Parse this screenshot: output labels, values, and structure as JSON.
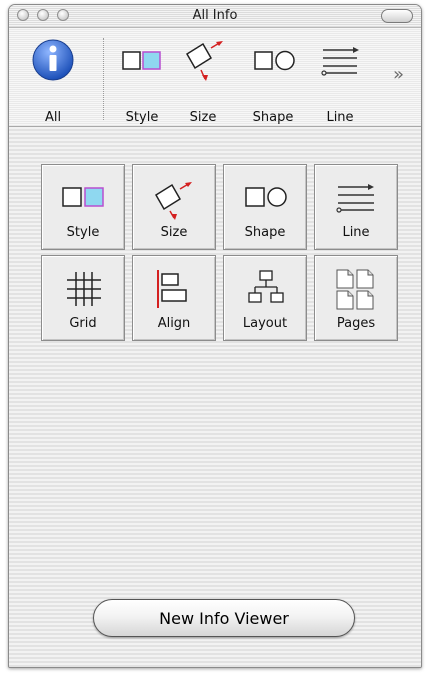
{
  "window": {
    "title": "All Info"
  },
  "toolbar": {
    "items": [
      {
        "label": "All",
        "icon": "info-icon"
      },
      {
        "label": "Style",
        "icon": "style-icon"
      },
      {
        "label": "Size",
        "icon": "size-icon"
      },
      {
        "label": "Shape",
        "icon": "shape-icon"
      },
      {
        "label": "Line",
        "icon": "line-icon"
      }
    ],
    "overflow_label": "»"
  },
  "inspectors": [
    {
      "label": "Style",
      "icon": "style-icon"
    },
    {
      "label": "Size",
      "icon": "size-icon"
    },
    {
      "label": "Shape",
      "icon": "shape-icon"
    },
    {
      "label": "Line",
      "icon": "line-icon"
    },
    {
      "label": "Grid",
      "icon": "grid-icon"
    },
    {
      "label": "Align",
      "icon": "align-icon"
    },
    {
      "label": "Layout",
      "icon": "layout-icon"
    },
    {
      "label": "Pages",
      "icon": "pages-icon"
    }
  ],
  "new_viewer_label": "New Info Viewer",
  "colors": {
    "info_blue": "#2d6ad6",
    "style_fill": "#8fd8f0",
    "style_border": "#b84fd0",
    "arrow_red": "#d42020",
    "align_red": "#d42020"
  }
}
